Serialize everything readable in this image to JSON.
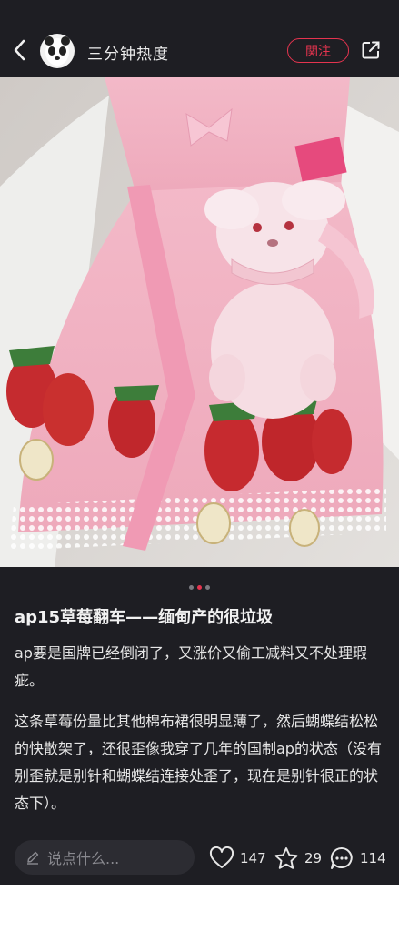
{
  "header": {
    "author_name": "三分钟热度",
    "follow_label": "関注"
  },
  "gallery": {
    "total": 3,
    "current": 1
  },
  "post": {
    "title": "ap15草莓翻车——缅甸产的很垃圾",
    "paragraphs": [
      "ap要是国牌已经倒闭了，又涨价又偷工减料又不处理瑕疵。",
      "这条草莓份量比其他棉布裙很明显薄了，然后蝴蝶结松松的快散架了，还很歪像我穿了几年的国制ap的状态（没有别歪就是别针和蝴蝶结连接处歪了，现在是别针很正的状态下）。"
    ]
  },
  "bottom": {
    "comment_placeholder": "说点什么...",
    "likes": "147",
    "collects": "29",
    "comments": "114"
  },
  "colors": {
    "background": "#1e1e23",
    "accent": "#e5344f",
    "text": "#e6e6e6"
  }
}
